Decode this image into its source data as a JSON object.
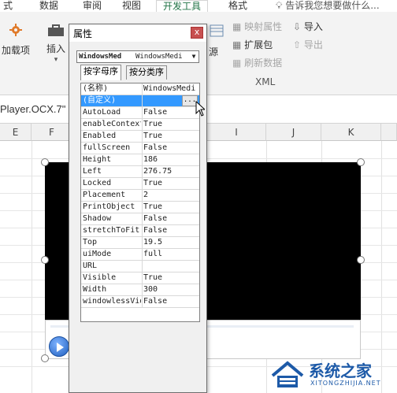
{
  "ribbon_tabs": [
    "式",
    "数据",
    "审阅",
    "视图",
    "开发工具",
    "格式"
  ],
  "active_tab": "开发工具",
  "tell_me": "告诉我您想要做什么...",
  "ribbon": {
    "addins": "加载项",
    "insert": "插入",
    "source_partial": "源",
    "xml_items": [
      "映射属性",
      "扩展包",
      "刷新数据"
    ],
    "xml_items_right": [
      "导入",
      "导出"
    ],
    "xml_group": "XML"
  },
  "formula_text": "Player.OCX.7\"",
  "columns": [
    "E",
    "F",
    "I",
    "J",
    "K"
  ],
  "properties": {
    "title": "属性",
    "close": "x",
    "object_name": "WindowsMed",
    "object_type": "WindowsMedi",
    "tabs": [
      "按字母序",
      "按分类序"
    ],
    "rows": [
      {
        "key": "(名称)",
        "value": "WindowsMedi"
      },
      {
        "key": "(自定义)",
        "value": ""
      },
      {
        "key": "AutoLoad",
        "value": "False"
      },
      {
        "key": "enableContext",
        "value": "True"
      },
      {
        "key": "Enabled",
        "value": "True"
      },
      {
        "key": "fullScreen",
        "value": "False"
      },
      {
        "key": "Height",
        "value": "186"
      },
      {
        "key": "Left",
        "value": "276.75"
      },
      {
        "key": "Locked",
        "value": "True"
      },
      {
        "key": "Placement",
        "value": "2"
      },
      {
        "key": "PrintObject",
        "value": "True"
      },
      {
        "key": "Shadow",
        "value": "False"
      },
      {
        "key": "stretchToFit",
        "value": "False"
      },
      {
        "key": "Top",
        "value": "19.5"
      },
      {
        "key": "uiMode",
        "value": "full"
      },
      {
        "key": "URL",
        "value": ""
      },
      {
        "key": "Visible",
        "value": "True"
      },
      {
        "key": "Width",
        "value": "300"
      },
      {
        "key": "windowlessVid",
        "value": "False"
      }
    ],
    "ellipsis": "..."
  },
  "watermark": {
    "cn": "系统之家",
    "en": "XITONGZHIJIA.NET"
  },
  "colors": {
    "accent": "#217346",
    "selection": "#3399ff",
    "video_bg": "#000000"
  }
}
